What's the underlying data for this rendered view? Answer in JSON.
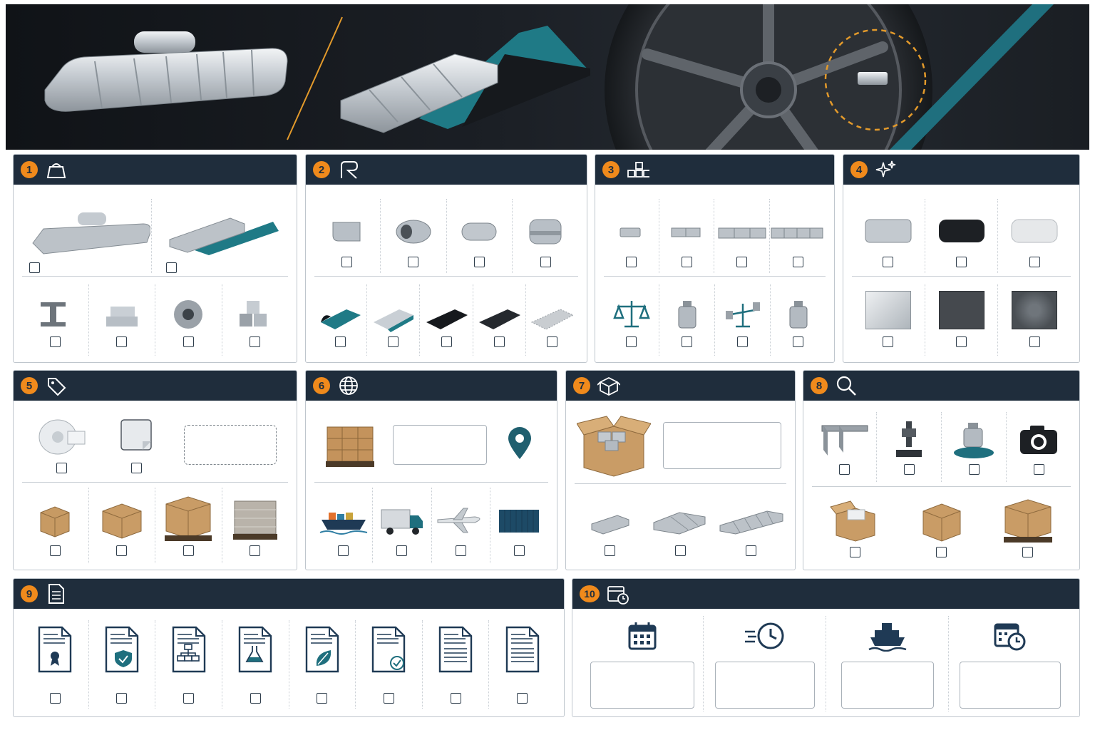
{
  "hero": {
    "description_items": [
      "clip-on-weight",
      "adhesive-weight",
      "wheel-with-weight"
    ]
  },
  "sections": [
    {
      "number": "1",
      "icon": "weight-icon"
    },
    {
      "number": "2",
      "icon": "clip-icon"
    },
    {
      "number": "3",
      "icon": "blocks-icon"
    },
    {
      "number": "4",
      "icon": "sparkle-icon"
    },
    {
      "number": "5",
      "icon": "tag-icon"
    },
    {
      "number": "6",
      "icon": "globe-icon"
    },
    {
      "number": "7",
      "icon": "package-icon"
    },
    {
      "number": "8",
      "icon": "search-icon"
    },
    {
      "number": "9",
      "icon": "document-icon"
    },
    {
      "number": "10",
      "icon": "calendar-clock-icon"
    }
  ],
  "colors": {
    "header_bg": "#1f2d3c",
    "badge": "#f08a1c",
    "teal": "#1f6f7e",
    "border": "#bfc6cd"
  }
}
